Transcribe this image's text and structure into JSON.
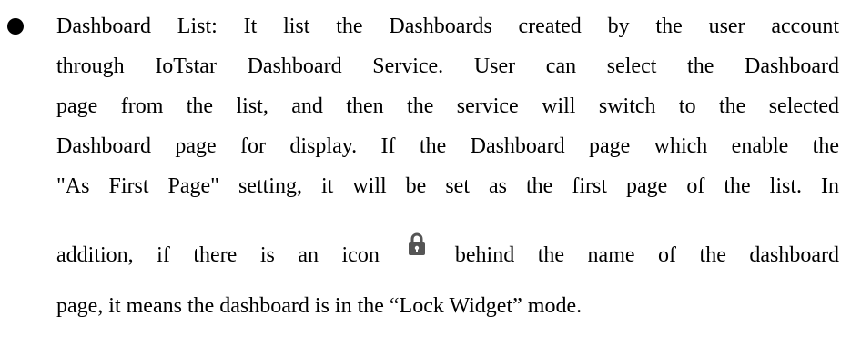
{
  "paragraph": {
    "lines": [
      "Dashboard List: It list the Dashboards created by the user account",
      "through IoTstar Dashboard Service. User can select the Dashboard",
      "page from the list, and then the service will switch to the selected",
      "Dashboard page for display. If the Dashboard page which enable the",
      "\"As First Page\" setting, it will be set as the first page of the list. In"
    ],
    "line6_before_icon": "addition, if there is an icon",
    "line6_after_icon": "behind the name of the dashboard",
    "line7": "page, it means the dashboard is in the “Lock Widget” mode."
  },
  "icons": {
    "bullet": "bullet-dot-icon",
    "lock": "lock-icon"
  },
  "colors": {
    "text": "#000000",
    "lock": "#555555"
  }
}
